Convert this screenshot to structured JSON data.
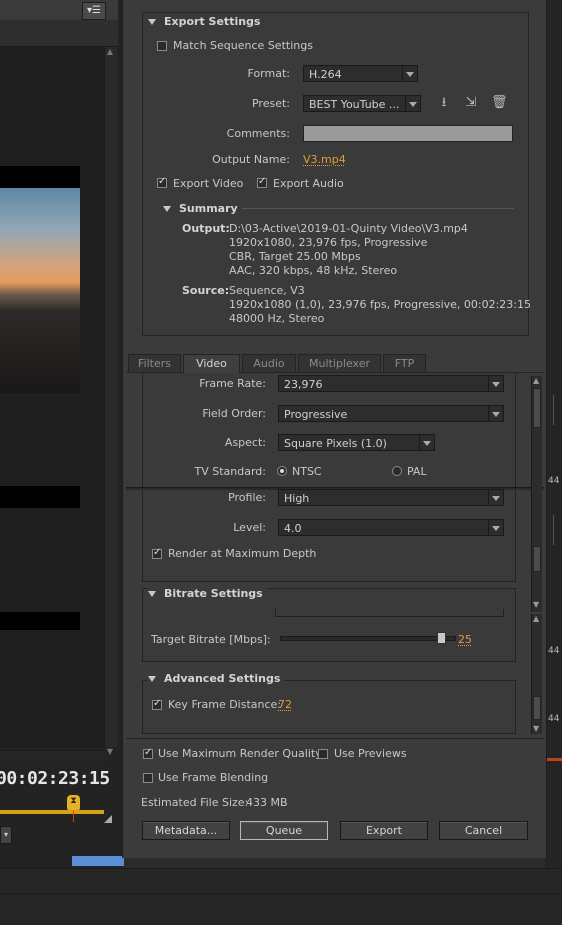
{
  "export_settings": {
    "header": "Export Settings",
    "match_sequence": "Match Sequence Settings",
    "format_label": "Format:",
    "format_value": "H.264",
    "preset_label": "Preset:",
    "preset_value": "BEST YouTube ...",
    "comments_label": "Comments:",
    "comments_value": "",
    "output_name_label": "Output Name:",
    "output_name_value": "V3.mp4",
    "export_video": "Export Video",
    "export_audio": "Export Audio",
    "summary": {
      "header": "Summary",
      "output_label": "Output:",
      "output_lines": [
        "D:\\03-Active\\2019-01-Quinty Video\\V3.mp4",
        "1920x1080, 23,976 fps, Progressive",
        "CBR, Target 25.00 Mbps",
        "AAC, 320 kbps, 48 kHz, Stereo"
      ],
      "source_label": "Source:",
      "source_lines": [
        "Sequence, V3",
        "1920x1080 (1,0), 23,976 fps, Progressive, 00:02:23:15",
        "48000 Hz, Stereo"
      ]
    }
  },
  "tabs": [
    {
      "label": "Filters",
      "active": false
    },
    {
      "label": "Video",
      "active": true
    },
    {
      "label": "Audio",
      "active": false
    },
    {
      "label": "Multiplexer",
      "active": false
    },
    {
      "label": "FTP",
      "active": false
    }
  ],
  "video": {
    "frame_rate_label": "Frame Rate:",
    "frame_rate_value": "23,976",
    "field_order_label": "Field Order:",
    "field_order_value": "Progressive",
    "aspect_label": "Aspect:",
    "aspect_value": "Square Pixels (1.0)",
    "tv_standard_label": "TV Standard:",
    "ntsc": "NTSC",
    "pal": "PAL",
    "profile_label": "Profile:",
    "profile_value": "High",
    "level_label": "Level:",
    "level_value": "4.0",
    "render_max_depth": "Render at Maximum Depth"
  },
  "bitrate": {
    "header": "Bitrate Settings",
    "target_label": "Target Bitrate [Mbps]:",
    "target_value": "25",
    "slider_fraction": 0.93
  },
  "advanced": {
    "header": "Advanced Settings",
    "key_frame_label": "Key Frame Distance:",
    "key_frame_value": "72"
  },
  "bottom": {
    "use_max_render": "Use Maximum Render Quality",
    "use_previews": "Use Previews",
    "use_frame_blending": "Use Frame Blending",
    "est_size_label": "Estimated File Size:",
    "est_size_value": "433 MB",
    "metadata_btn": "Metadata...",
    "queue_btn": "Queue",
    "export_btn": "Export",
    "cancel_btn": "Cancel"
  },
  "preview": {
    "timecode": "00:02:23:15"
  },
  "right_strip_marks": [
    ":44",
    ":44",
    ":44"
  ],
  "colors": {
    "accent_orange": "#d9a03a",
    "timeline_yellow": "#d6a21a",
    "dialog_bg": "#3b3b3b"
  }
}
